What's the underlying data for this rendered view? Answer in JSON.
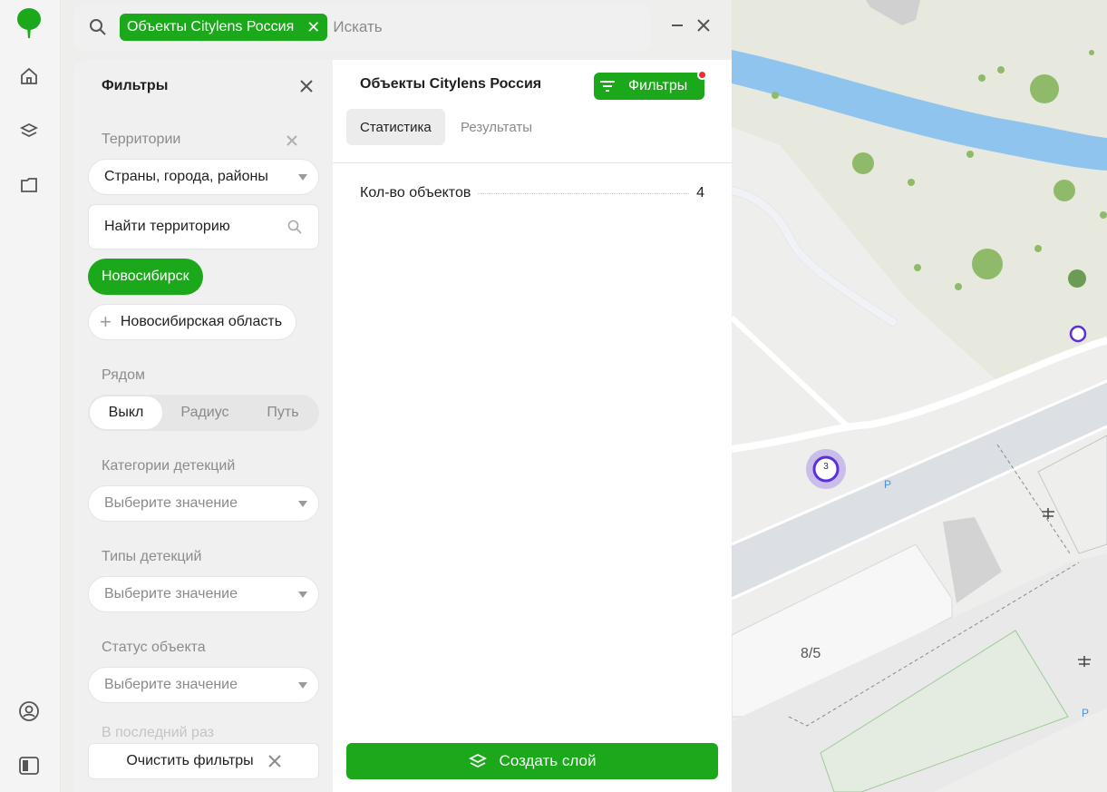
{
  "search": {
    "chip_label": "Объекты Citylens Россия",
    "placeholder": "Искать"
  },
  "filters_panel": {
    "title": "Фильтры",
    "territories_label": "Территории",
    "territory_type_value": "Страны, города, районы",
    "find_territory_placeholder": "Найти территорию",
    "selected_territory": "Новосибирск",
    "suggested_territory": "Новосибирская область",
    "nearby_label": "Рядом",
    "nearby_options": [
      "Выкл",
      "Радиус",
      "Путь"
    ],
    "detection_categories_label": "Категории детекций",
    "detection_types_label": "Типы детекций",
    "object_status_label": "Статус объекта",
    "select_placeholder": "Выберите значение",
    "last_time_label": "В последний раз",
    "clear_button": "Очистить фильтры"
  },
  "results_panel": {
    "title": "Объекты Citylens Россия",
    "filters_button": "Фильтры",
    "tabs": [
      "Статистика",
      "Результаты"
    ],
    "stat_label": "Кол-во объектов",
    "stat_value": "4",
    "create_layer_button": "Создать слой"
  },
  "map": {
    "cluster_count": "3",
    "building_number": "8/5",
    "parking_label_1": "P",
    "parking_label_2": "P"
  },
  "colors": {
    "accent": "#1ba81b",
    "notification_dot": "#e8302f",
    "marker": "#5b2ee0",
    "river": "#8fc4ee"
  },
  "icons": {
    "rail": [
      "home-icon",
      "layers-icon",
      "folder-icon",
      "user-icon",
      "panel-icon"
    ]
  }
}
